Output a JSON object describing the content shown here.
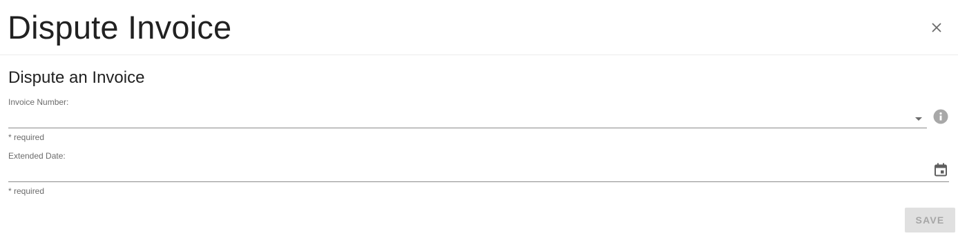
{
  "dialog": {
    "title": "Dispute Invoice",
    "close_icon": "close-icon"
  },
  "form": {
    "subtitle": "Dispute an Invoice",
    "invoice_number": {
      "label": "Invoice Number:",
      "value": "",
      "helper": "* required",
      "dropdown_icon": "chevron-down-icon",
      "info_icon": "info-icon"
    },
    "extended_date": {
      "label": "Extended Date:",
      "value": "",
      "helper": "* required",
      "calendar_icon": "calendar-icon"
    },
    "save_label": "SAVE",
    "save_enabled": false
  },
  "colors": {
    "text_primary": "#212121",
    "text_secondary": "#6b6b6b",
    "icon_gray": "#9e9e9e",
    "disabled_bg": "#e0e0e0",
    "disabled_text": "#a6a6a6"
  }
}
